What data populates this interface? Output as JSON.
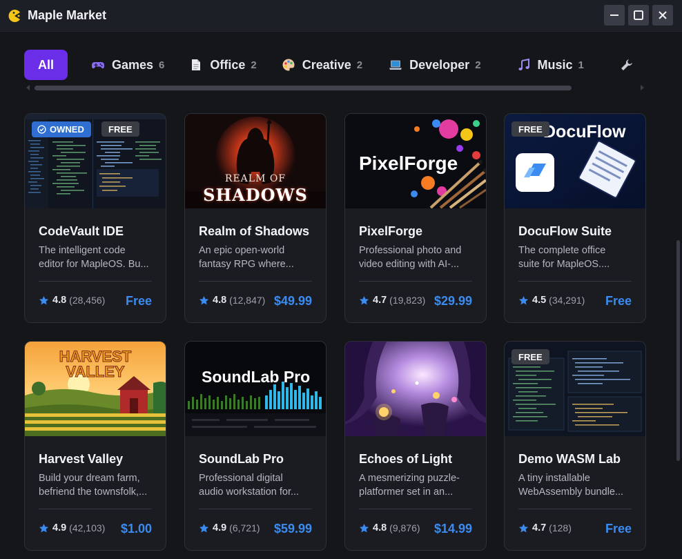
{
  "window": {
    "title": "Maple Market",
    "logo_icon": "pacman-logo-icon",
    "controls": [
      "minimize-icon",
      "maximize-icon",
      "close-icon"
    ]
  },
  "tabs": [
    {
      "label": "All",
      "count": "",
      "icon": "",
      "active": true
    },
    {
      "label": "Games",
      "count": "6",
      "icon": "gamepad-icon"
    },
    {
      "label": "Office",
      "count": "2",
      "icon": "document-icon"
    },
    {
      "label": "Creative",
      "count": "2",
      "icon": "palette-icon"
    },
    {
      "label": "Developer",
      "count": "2",
      "icon": "laptop-icon"
    },
    {
      "label": "Music",
      "count": "1",
      "icon": "music-note-icon"
    },
    {
      "label": "",
      "count": "",
      "icon": "wrench-icon"
    }
  ],
  "colors": {
    "accent": "#6b2ee8",
    "price": "#3b8bf0",
    "owned_badge": "#2f6fd1",
    "star": "#3b8bf0"
  },
  "apps": [
    {
      "title": "CodeVault IDE",
      "desc_line1": "The intelligent code",
      "desc_line2": "editor for MapleOS. Bu...",
      "rating": "4.8",
      "reviews": "(28,456)",
      "price": "Free",
      "owned_label": "OWNED",
      "free_label": "FREE"
    },
    {
      "title": "Realm of Shadows",
      "desc_line1": "An epic open-world",
      "desc_line2": "fantasy RPG where...",
      "rating": "4.8",
      "reviews": "(12,847)",
      "price": "$49.99",
      "art_line1": "REALM OF",
      "art_line2": "SHADOWS"
    },
    {
      "title": "PixelForge",
      "desc_line1": "Professional photo and",
      "desc_line2": "video editing with AI-...",
      "rating": "4.7",
      "reviews": "(19,823)",
      "price": "$29.99",
      "art_text": "PixelForge"
    },
    {
      "title": "DocuFlow Suite",
      "desc_line1": "The complete office",
      "desc_line2": "suite for MapleOS....",
      "rating": "4.5",
      "reviews": "(34,291)",
      "price": "Free",
      "free_label": "FREE",
      "art_text": "DocuFlow"
    },
    {
      "title": "Harvest Valley",
      "desc_line1": "Build your dream farm,",
      "desc_line2": "befriend the townsfolk,...",
      "rating": "4.9",
      "reviews": "(42,103)",
      "price": "$1.00",
      "art_line1": "HARVEST",
      "art_line2": "VALLEY"
    },
    {
      "title": "SoundLab Pro",
      "desc_line1": "Professional digital",
      "desc_line2": "audio workstation for...",
      "rating": "4.9",
      "reviews": "(6,721)",
      "price": "$59.99",
      "art_text": "SoundLab Pro"
    },
    {
      "title": "Echoes of Light",
      "desc_line1": "A mesmerizing puzzle-",
      "desc_line2": "platformer set in an...",
      "rating": "4.8",
      "reviews": "(9,876)",
      "price": "$14.99"
    },
    {
      "title": "Demo WASM Lab",
      "desc_line1": "A tiny installable",
      "desc_line2": "WebAssembly bundle...",
      "rating": "4.7",
      "reviews": "(128)",
      "price": "Free",
      "free_label": "FREE"
    }
  ]
}
